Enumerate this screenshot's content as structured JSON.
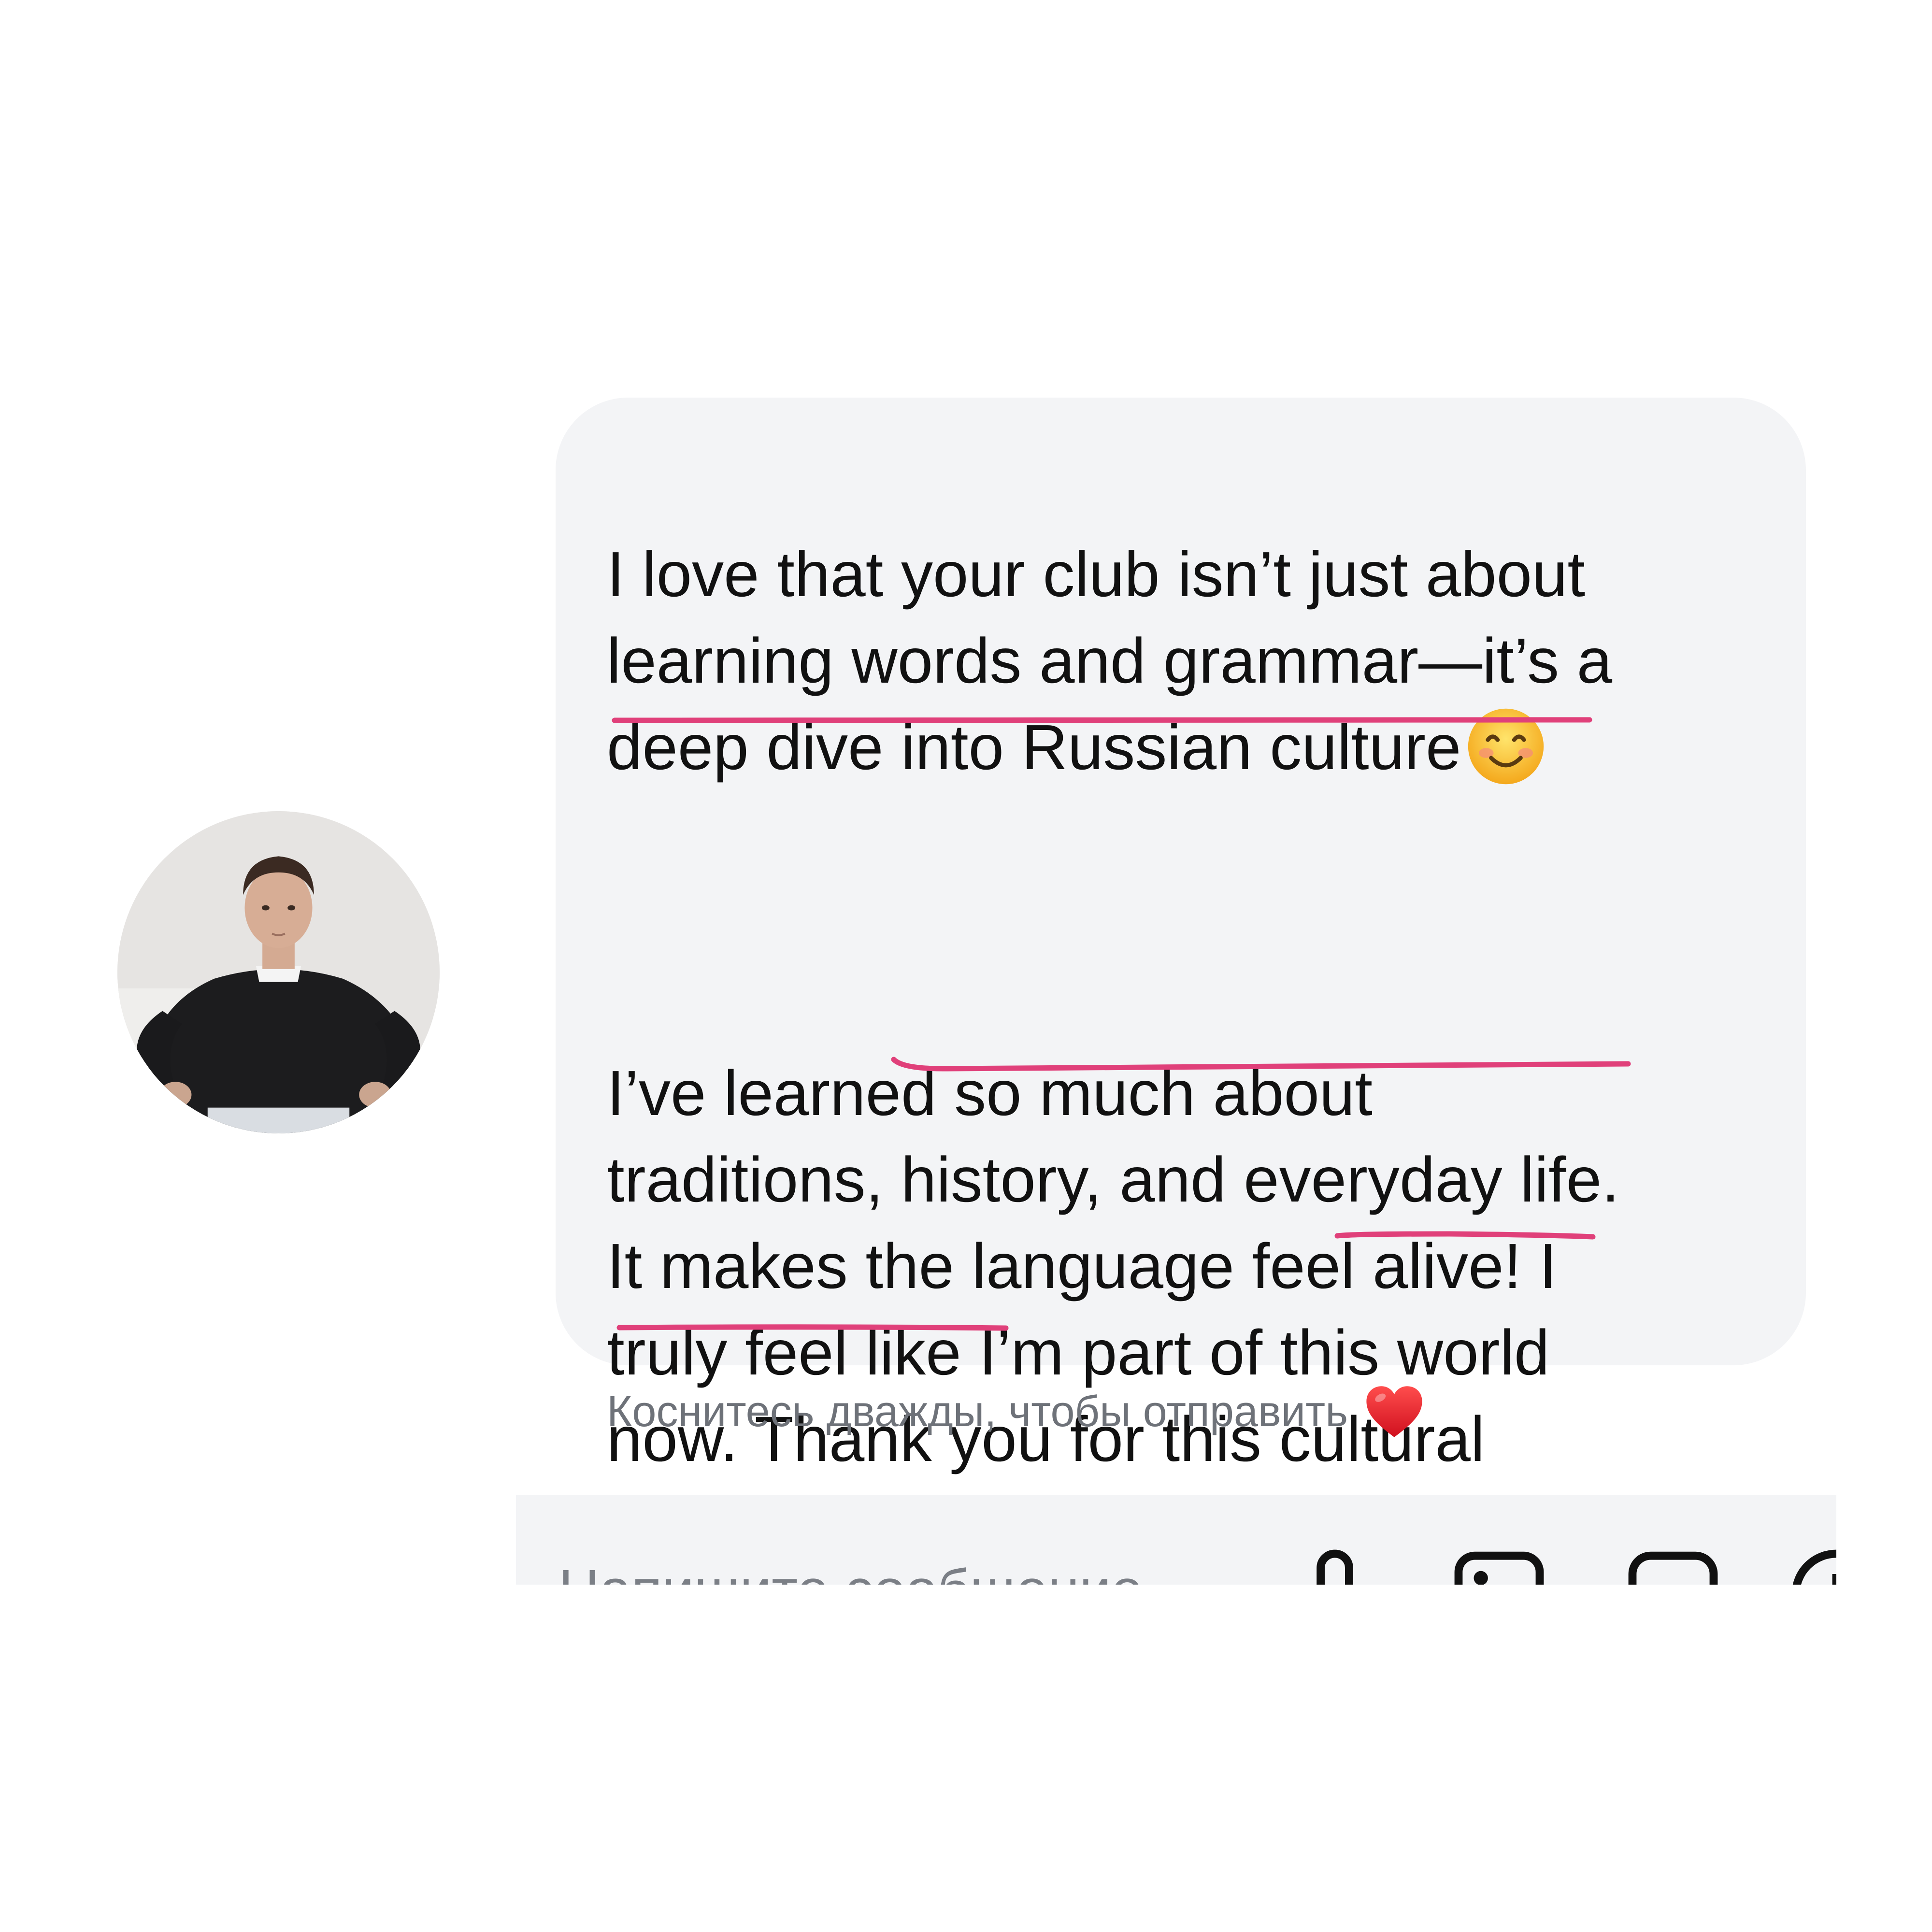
{
  "chat": {
    "message": {
      "paragraph_1": "I love that your club isn’t just about\nlearning words and grammar—it’s a\ndeep dive into Russian culture",
      "paragraph_1_emoji": "smiling-face-emoji",
      "paragraph_2": "I’ve learned so much about\ntraditions, history, and everyday life.\nIt makes the language feel alive! I\ntruly feel like I’m part of this world\nnow. Thank you for this cultural\nexperience!",
      "highlight_color": "#e0407a"
    },
    "reaction_hint": "Коснитесь дважды, чтобы отправить",
    "reaction_icon": "red-heart-icon"
  },
  "composer": {
    "placeholder": "Напишите сообщение...",
    "icons": [
      "microphone-icon",
      "image-icon",
      "sticker-icon",
      "add-circle-icon"
    ]
  },
  "colors": {
    "bubble": "#f3f4f6",
    "text": "#111111",
    "muted": "#6e7279",
    "underline": "#e0407a"
  }
}
